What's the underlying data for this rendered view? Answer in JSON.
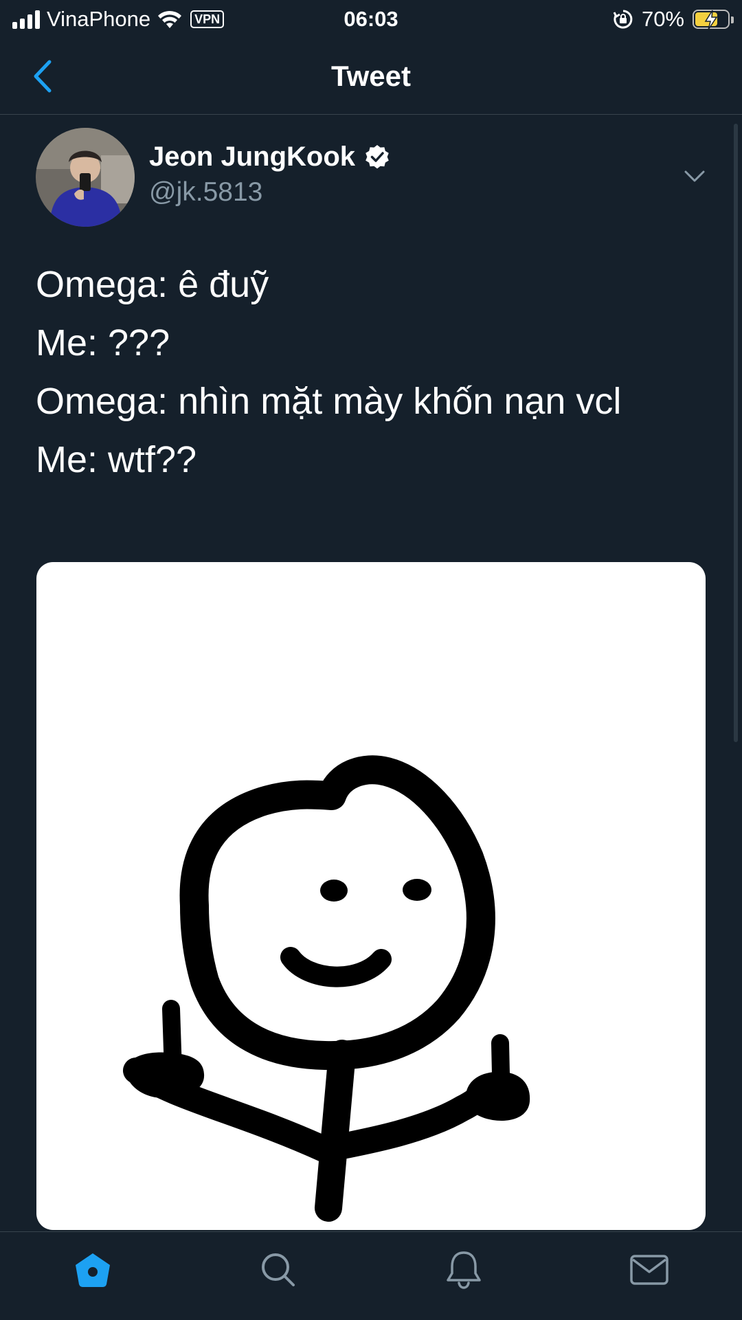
{
  "status_bar": {
    "carrier": "VinaPhone",
    "vpn": "VPN",
    "time": "06:03",
    "battery_percent_text": "70%",
    "battery_level": 0.7
  },
  "header": {
    "title": "Tweet",
    "back_icon": "chevron-left-icon"
  },
  "tweet": {
    "author_name": "Jeon JungKook",
    "author_handle": "@jk.5813",
    "verified_icon": "verified-badge-icon",
    "menu_icon": "chevron-down-icon",
    "lines": [
      "Omega: ê đuỹ",
      "Me: ???",
      "Omega: nhìn mặt mày khốn nạn vcl",
      "Me: wtf??"
    ],
    "media": "stick-figure-meme-image"
  },
  "tab_bar": {
    "items": [
      {
        "icon": "home-icon",
        "active": true
      },
      {
        "icon": "search-icon",
        "active": false
      },
      {
        "icon": "bell-icon",
        "active": false
      },
      {
        "icon": "mail-icon",
        "active": false
      }
    ]
  },
  "colors": {
    "background": "#15202b",
    "accent": "#1da1f2",
    "secondary_text": "#8899a6",
    "divider": "#38444d"
  }
}
